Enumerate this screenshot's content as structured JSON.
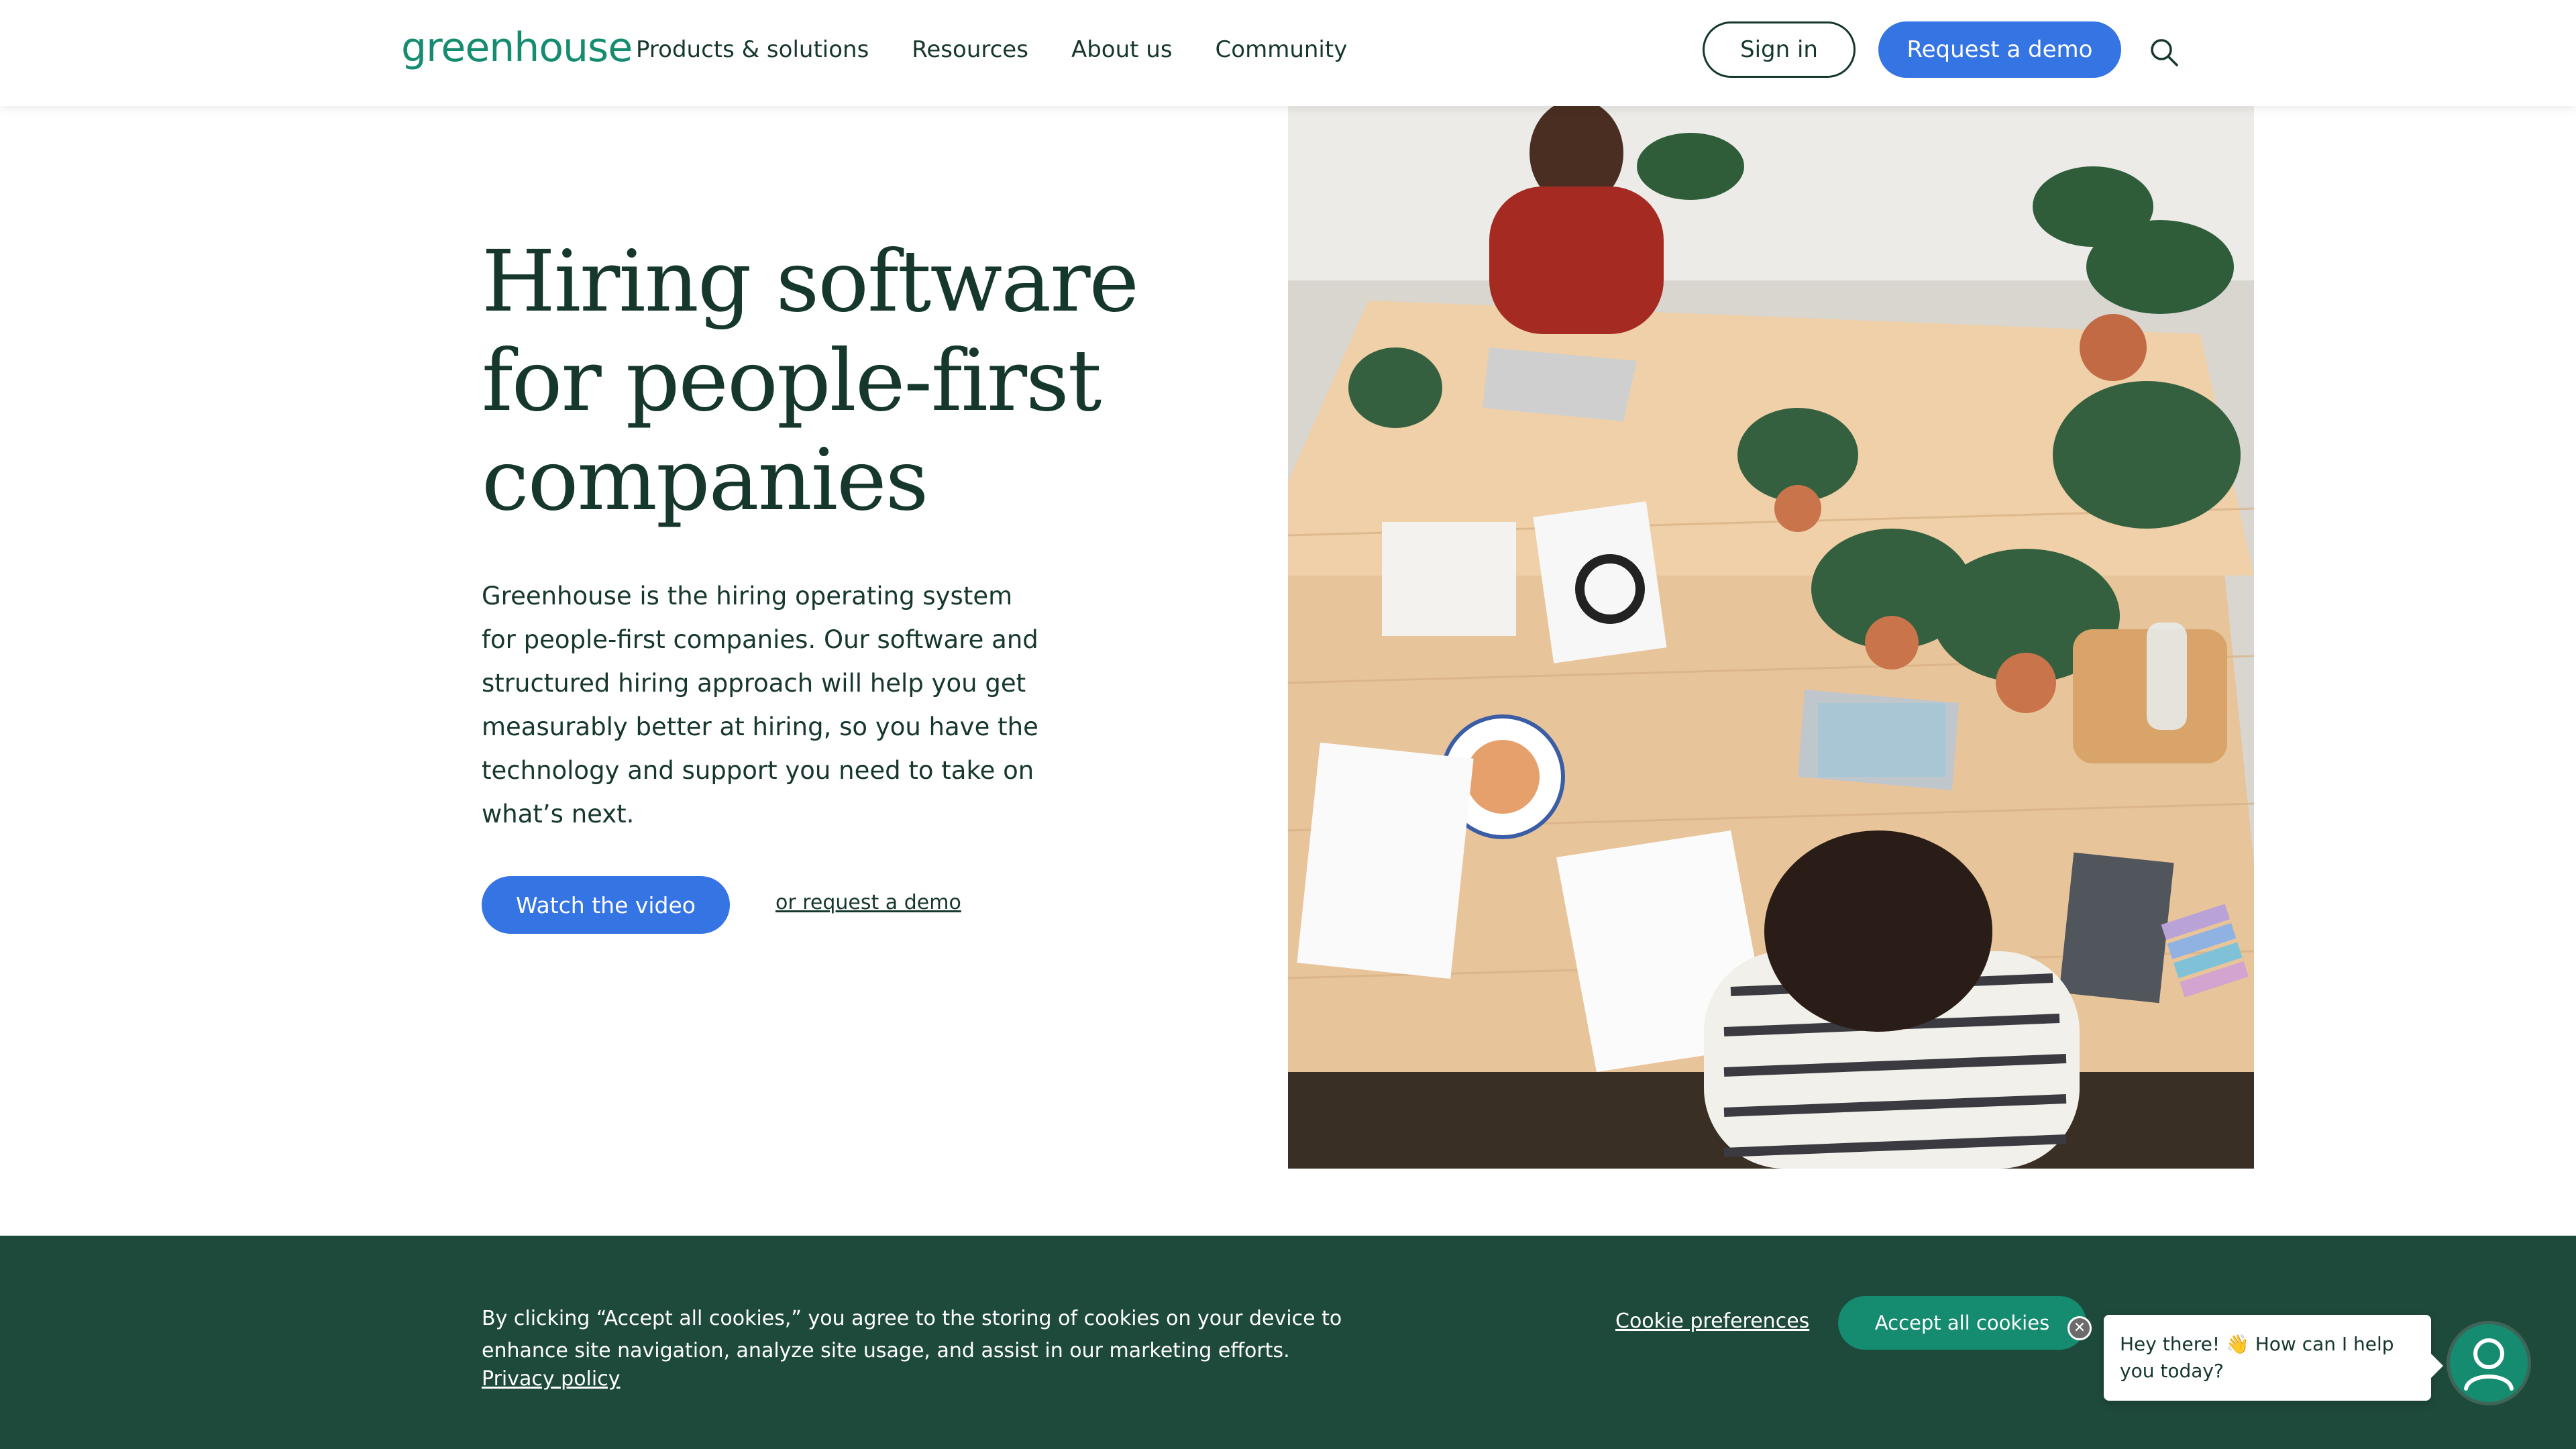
{
  "header": {
    "logo": "greenhouse",
    "nav": [
      "Products & solutions",
      "Resources",
      "About us",
      "Community"
    ],
    "sign_in": "Sign in",
    "request_demo": "Request a demo",
    "search_icon": "search-icon"
  },
  "hero": {
    "title": "Hiring software for people-first companies",
    "body": "Greenhouse is the hiring operating system for people-first companies. Our software and structured hiring approach will help you get measurably better at hiring, so you have the technology and support you need to take on what’s next.",
    "watch_video": "Watch the video",
    "request_demo_link": "or request a demo"
  },
  "cookie_banner": {
    "text": "By clicking “Accept all cookies,” you agree to the storing of cookies on your device to enhance site navigation, analyze site usage, and assist in our marketing efforts.",
    "privacy": "Privacy policy",
    "preferences": "Cookie preferences",
    "accept": "Accept all cookies"
  },
  "chat": {
    "message": "Hey there! 👋 How can I help you today?"
  },
  "colors": {
    "brand_green": "#158b6f",
    "dark_text": "#15372c",
    "accent_blue": "#3574e3",
    "banner_bg": "#1e4a3c"
  }
}
